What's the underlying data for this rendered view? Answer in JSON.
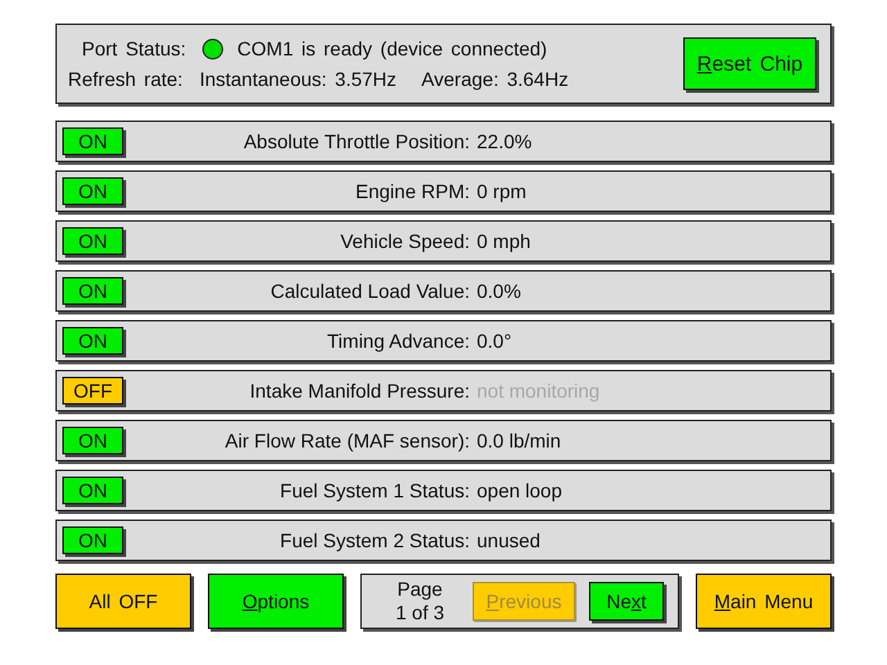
{
  "port_status": {
    "label": "Port Status:",
    "connected": true,
    "color": "#00e000",
    "message": "COM1 is ready (device connected)"
  },
  "refresh_rate": {
    "label": "Refresh rate:",
    "instantaneous": "Instantaneous: 3.57Hz",
    "average": "Average: 3.64Hz"
  },
  "reset_button": {
    "label": [
      {
        "text": "R",
        "underlined": true
      },
      {
        "text": "eset Chip",
        "underlined": false
      }
    ]
  },
  "sensors": [
    {
      "toggle": "ON",
      "on": true,
      "name": "Absolute Throttle Position:",
      "value": "22.0%"
    },
    {
      "toggle": "ON",
      "on": true,
      "name": "Engine RPM:",
      "value": "0 rpm"
    },
    {
      "toggle": "ON",
      "on": true,
      "name": "Vehicle Speed:",
      "value": "0 mph"
    },
    {
      "toggle": "ON",
      "on": true,
      "name": "Calculated Load Value:",
      "value": "0.0%"
    },
    {
      "toggle": "ON",
      "on": true,
      "name": "Timing Advance:",
      "value": "0.0°"
    },
    {
      "toggle": "OFF",
      "on": false,
      "name": "Intake Manifold Pressure:",
      "value": "not monitoring"
    },
    {
      "toggle": "ON",
      "on": true,
      "name": "Air Flow Rate (MAF sensor):",
      "value": "0.0 lb/min"
    },
    {
      "toggle": "ON",
      "on": true,
      "name": "Fuel System 1 Status:",
      "value": "open loop"
    },
    {
      "toggle": "ON",
      "on": true,
      "name": "Fuel System 2 Status:",
      "value": "unused"
    }
  ],
  "all_off_button": {
    "label": "All OFF"
  },
  "options_button": {
    "label": [
      {
        "text": "O",
        "underlined": true
      },
      {
        "text": "ptions",
        "underlined": false
      }
    ]
  },
  "pager": {
    "page_label": "Page",
    "page_count": "1 of 3",
    "previous": {
      "label": [
        {
          "text": "P",
          "underlined": true
        },
        {
          "text": "revious",
          "underlined": false
        }
      ],
      "disabled": true
    },
    "next": {
      "label": [
        {
          "text": "Ne",
          "underlined": false
        },
        {
          "text": "x",
          "underlined": true
        },
        {
          "text": "t",
          "underlined": false
        }
      ],
      "disabled": false
    }
  },
  "main_menu_button": {
    "label": [
      {
        "text": "M",
        "underlined": true
      },
      {
        "text": "ain Menu",
        "underlined": false
      }
    ]
  }
}
